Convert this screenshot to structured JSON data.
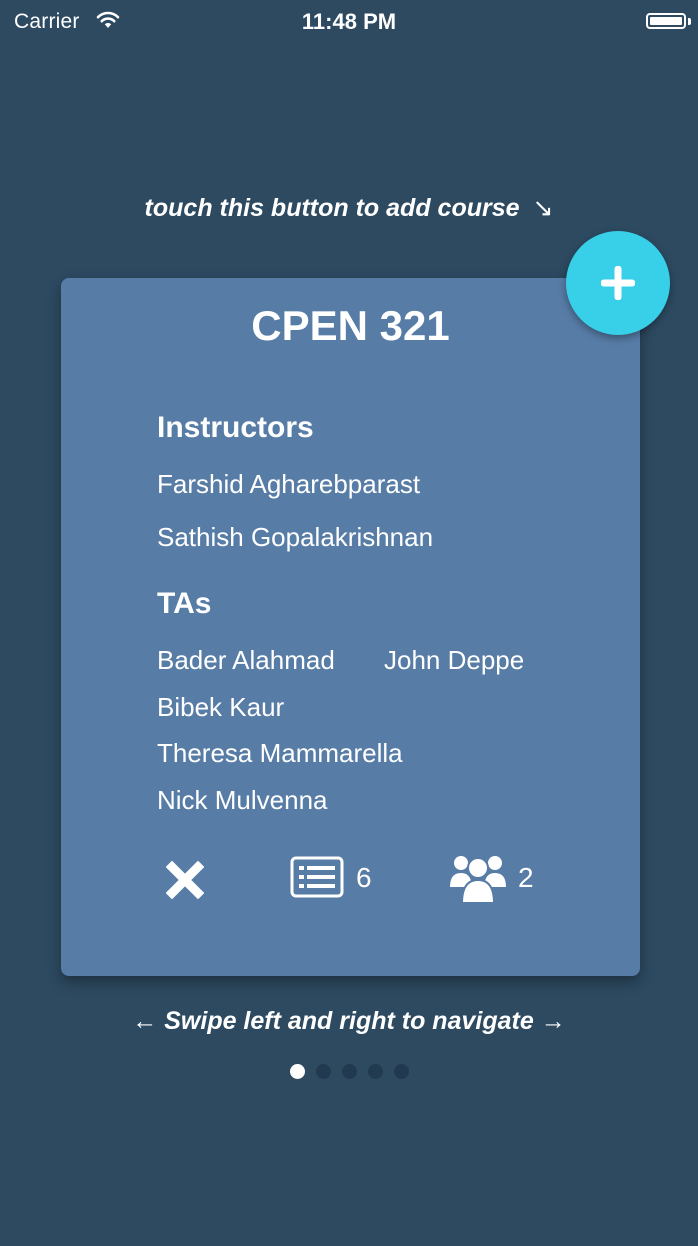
{
  "status_bar": {
    "carrier": "Carrier",
    "time": "11:48 PM"
  },
  "hints": {
    "add_course": "touch this button to add course",
    "add_course_arrow": "↘",
    "navigate": "Swipe left and right to navigate",
    "navigate_arrow_left": "←",
    "navigate_arrow_right": "→"
  },
  "card": {
    "title": "CPEN 321",
    "instructors_heading": "Instructors",
    "instructors": [
      "Farshid Agharebparast",
      "Sathish Gopalakrishnan"
    ],
    "tas_heading": "TAs",
    "tas": [
      "Bader Alahmad",
      "John Deppe",
      "Bibek Kaur",
      "Theresa Mammarella",
      "Nick Mulvenna"
    ],
    "list_count": "6",
    "group_count": "2"
  },
  "pagination": {
    "total": 5,
    "active_index": 0
  },
  "colors": {
    "background": "#2d4a61",
    "card": "#577ca6",
    "fab": "#38cfe9",
    "dot_inactive": "#223a4f"
  },
  "icons": [
    "wifi-icon",
    "battery-icon",
    "plus-icon",
    "close-icon",
    "list-icon",
    "group-icon"
  ]
}
